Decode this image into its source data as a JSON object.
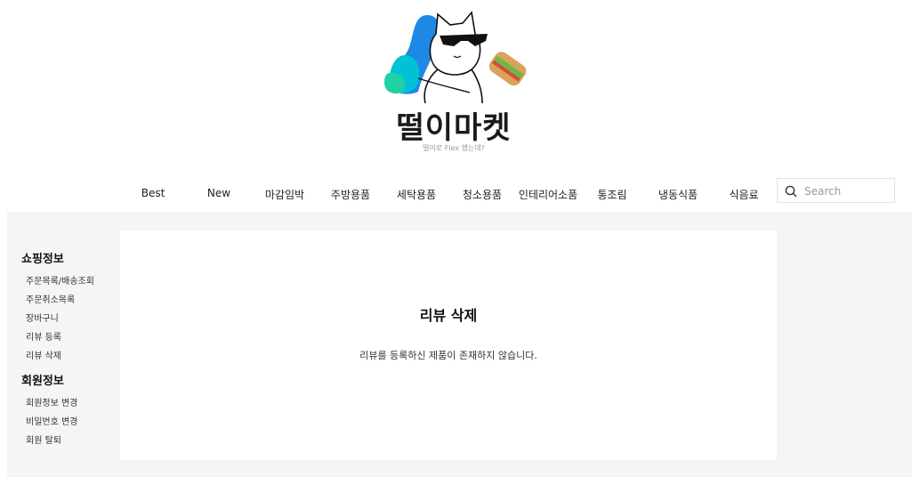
{
  "brand": {
    "name": "떨이마켓",
    "tagline": "떨이로 Flex 했는데?"
  },
  "nav": {
    "items": [
      "Best",
      "New",
      "마감임박",
      "주방용품",
      "세탁용품",
      "청소용품",
      "인테리어소품",
      "통조림",
      "냉동식품",
      "식음료"
    ]
  },
  "search": {
    "placeholder": "Search"
  },
  "sidebar": {
    "shopping_heading": "쇼핑정보",
    "shopping_links": [
      "주문목록/배송조회",
      "주문취소목록",
      "장바구니",
      "리뷰 등록",
      "리뷰 삭제"
    ],
    "member_heading": "회원정보",
    "member_links": [
      "회원정보 변경",
      "비밀번호 변경",
      "회원 탈퇴"
    ]
  },
  "main": {
    "title": "리뷰 삭제",
    "message": "리뷰를 등록하신 제품이 존재하지 않습니다."
  },
  "colors": {
    "accent_blue": "#1e88e5",
    "accent_cyan": "#00c2d6",
    "accent_teal": "#1fd1a5",
    "panel_bg": "#f5f5f5"
  }
}
